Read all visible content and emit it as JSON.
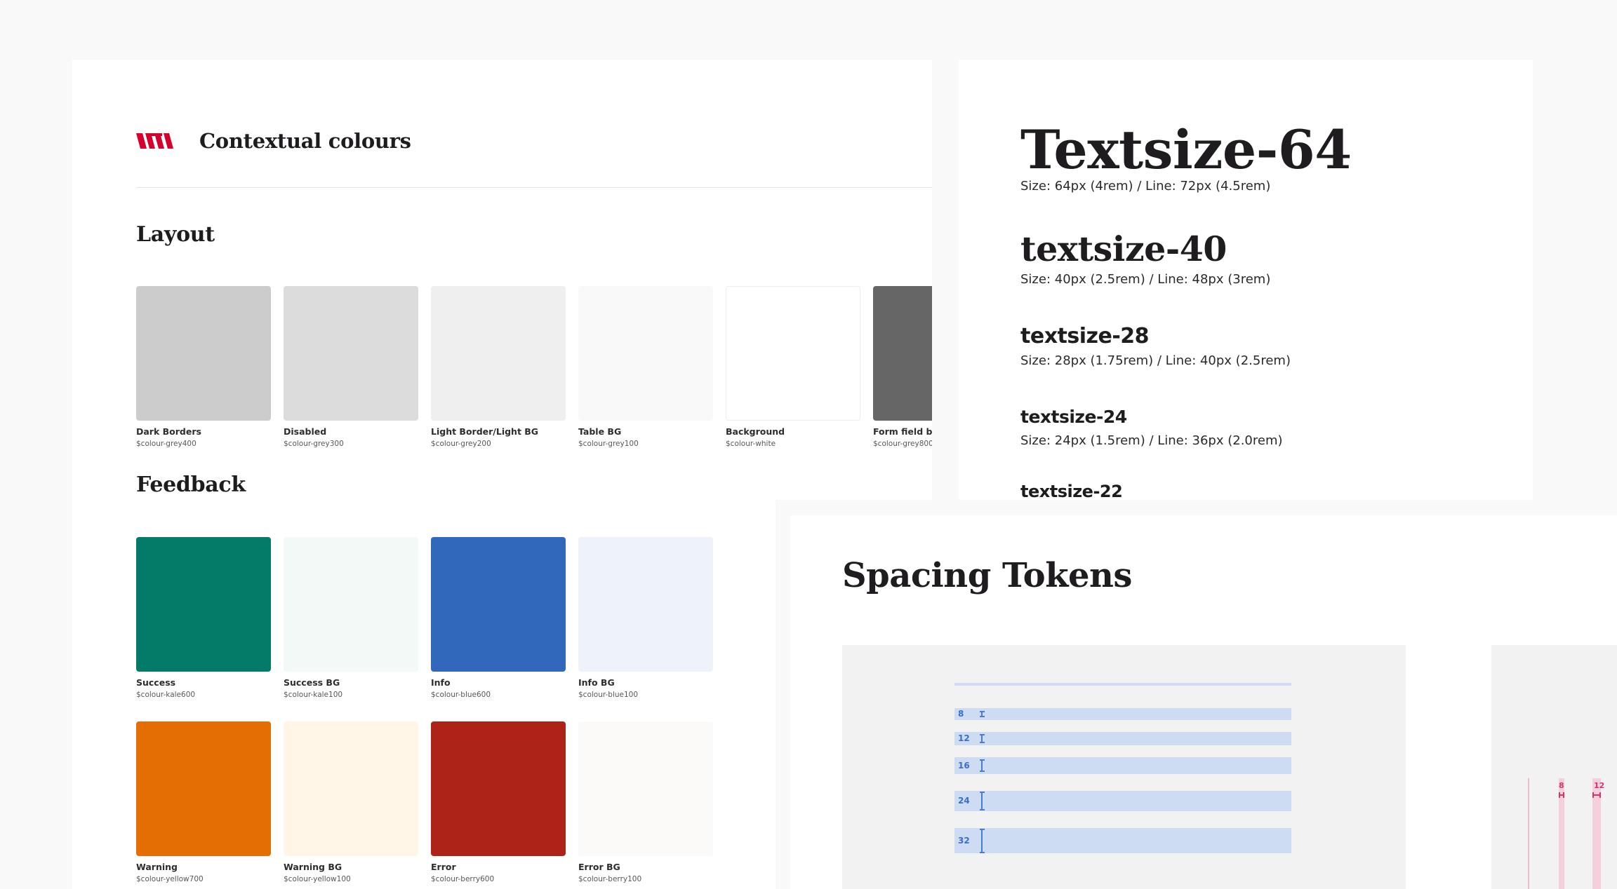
{
  "colours_panel": {
    "title": "Contextual colours",
    "sections": {
      "layout": {
        "heading": "Layout",
        "swatches": [
          {
            "name": "Dark Borders",
            "token": "$colour-grey400",
            "color": "#cccccc"
          },
          {
            "name": "Disabled",
            "token": "$colour-grey300",
            "color": "#dcdcdc"
          },
          {
            "name": "Light Border/Light BG",
            "token": "$colour-grey200",
            "color": "#efefef"
          },
          {
            "name": "Table BG",
            "token": "$colour-grey100",
            "color": "#f9f9f9"
          },
          {
            "name": "Background",
            "token": "$colour-white",
            "color": "#ffffff"
          },
          {
            "name": "Form field border",
            "token": "$colour-grey800",
            "color": "#666666"
          }
        ]
      },
      "feedback": {
        "heading": "Feedback",
        "swatches": [
          {
            "name": "Success",
            "token": "$colour-kale600",
            "color": "#037b68"
          },
          {
            "name": "Success BG",
            "token": "$colour-kale100",
            "color": "#f2f9f7"
          },
          {
            "name": "Info",
            "token": "$colour-blue600",
            "color": "#3268bb"
          },
          {
            "name": "Info BG",
            "token": "$colour-blue100",
            "color": "#eef2fa"
          },
          {
            "name": "Warning",
            "token": "$colour-yellow700",
            "color": "#e46e04"
          },
          {
            "name": "Warning BG",
            "token": "$colour-yellow100",
            "color": "#fff6e8"
          },
          {
            "name": "Error",
            "token": "$colour-berry600",
            "color": "#ad2317"
          },
          {
            "name": "Error BG",
            "token": "$colour-berry100",
            "color": "#fcf9f9"
          }
        ]
      }
    },
    "brand_color": "#d5002b"
  },
  "typography_panel": {
    "sizes": [
      {
        "name": "Textsize-64",
        "meta": "Size: 64px (4rem) / Line: 72px (4.5rem)"
      },
      {
        "name": "textsize-40",
        "meta": "Size: 40px (2.5rem) / Line: 48px (3rem)"
      },
      {
        "name": "textsize-28",
        "meta": "Size: 28px (1.75rem) / Line: 40px (2.5rem)"
      },
      {
        "name": "textsize-24",
        "meta": "Size: 24px (1.5rem) / Line: 36px (2.0rem)"
      },
      {
        "name": "textsize-22",
        "meta": ""
      }
    ]
  },
  "spacing_panel": {
    "title": "Spacing Tokens",
    "vertical_tokens": [
      {
        "label": "8",
        "value": 8
      },
      {
        "label": "12",
        "value": 12
      },
      {
        "label": "16",
        "value": 16
      },
      {
        "label": "24",
        "value": 24
      },
      {
        "label": "32",
        "value": 32
      }
    ],
    "horizontal_tokens": [
      {
        "label": "8",
        "value": 8
      },
      {
        "label": "12",
        "value": 12
      }
    ],
    "colors": {
      "vertical_bar": "#cddcf2",
      "vertical_label": "#3a6fc6",
      "horizontal_label": "#d6336c"
    }
  }
}
